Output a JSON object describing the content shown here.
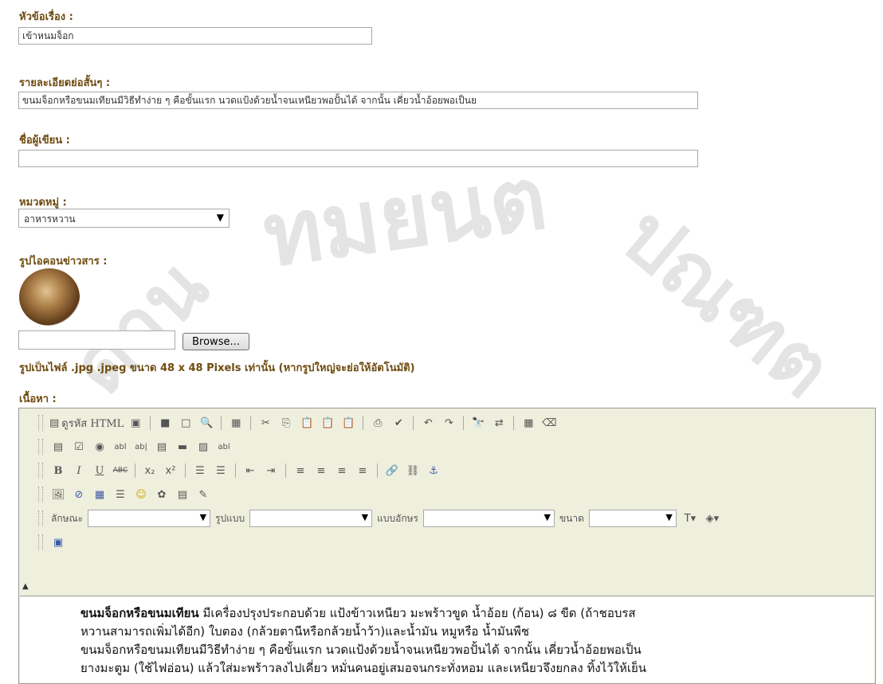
{
  "form": {
    "title_label": "หัวข้อเรื่อง :",
    "title_value": "เข้าหนมจ็อก",
    "summary_label": "รายละเอียดย่อสั้นๆ :",
    "summary_value": "ขนมจ็อกหรือขนมเทียนมีวิธีทำง่าย ๆ คือขั้นแรก นวดแป้งด้วยน้ำจนเหนียวพอปั้นได้ จากนั้น เคี่ยวน้ำอ้อยพอเป็นย",
    "author_label": "ชื่อผู้เขียน :",
    "author_value": "",
    "category_label": "หมวดหมู่ :",
    "category_value": "อาหารหวาน",
    "icon_label": "รูปไอคอนข่าวสาร :",
    "browse_label": "Browse...",
    "icon_note": "รูปเป็นไฟล์ .jpg .jpeg ขนาด 48 x 48 Pixels เท่านั้น (หากรูปใหญ่จะย่อให้อัตโนมัติ)",
    "content_label": "เนื้อหา :"
  },
  "editor": {
    "source_label": "ดูรหัส HTML",
    "style_label": "ลักษณะ",
    "format_label": "รูปแบบ",
    "font_label": "แบบอักษร",
    "size_label": "ขนาด",
    "body_bold": "ขนมจ็อกหรือขนมเทียน",
    "body_line1": " มีเครื่องปรุงประกอบด้วย แป้งข้าวเหนียว มะพร้าวขูด น้ำอ้อย (ก้อน) ๘ ขีด (ถ้าชอบรส",
    "body_line2": "หวานสามารถเพิ่มได้อีก) ใบตอง (กล้วยตานีหรือกล้วยน้ำว้า)และน้ำมัน หมูหรือ น้ำมันพืช",
    "body_line3": "ขนมจ็อกหรือขนมเทียนมีวิธีทำง่าย ๆ คือขั้นแรก นวดแป้งด้วยน้ำจนเหนียวพอปั้นได้ จากนั้น เคี่ยวน้ำอ้อยพอเป็น",
    "body_line4": "ยางมะตูม (ใช้ไฟอ่อน) แล้วใส่มะพร้าวลงไปเคี่ยว หมั่นคนอยู่เสมอจนกระทั่งหอม และเหนียวจึงยกลง ทิ้งไว้ให้เย็น"
  },
  "watermark": {
    "text1": "ทมยนต",
    "text2": "ปณฑต",
    "text3": "ดาน"
  }
}
